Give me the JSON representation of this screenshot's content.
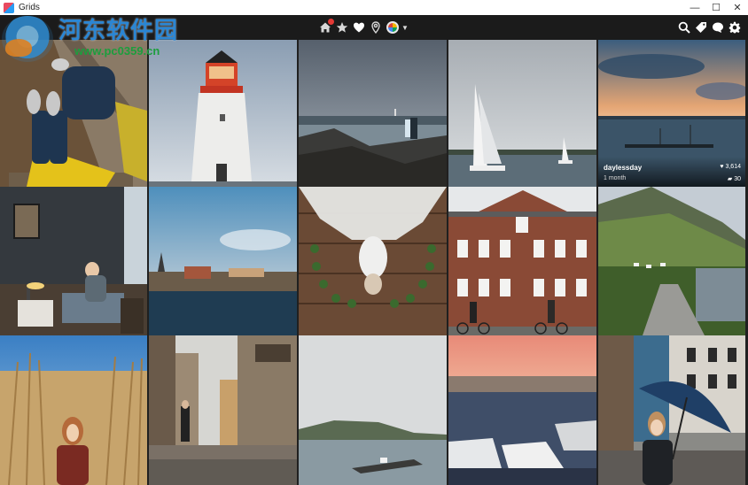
{
  "window": {
    "title": "Grids"
  },
  "watermark": {
    "text": "河东软件园",
    "url": "www.pc0359.cn"
  },
  "toolbar": {
    "center_icons": [
      "home-icon",
      "star-icon",
      "heart-icon",
      "location-pin-icon",
      "profile-avatar",
      "dropdown-caret-icon"
    ],
    "right_icons": [
      "search-icon",
      "tag-icon",
      "chat-icon",
      "gear-icon"
    ],
    "notification": true
  },
  "photo_overlay": {
    "username": "daylessday",
    "age": "1 month",
    "likes": "3,614",
    "comments": "30"
  },
  "colors": {
    "titlebar_bg": "#ffffff",
    "toolbar_bg": "#1b1b1b",
    "grid_bg": "#202020",
    "badge": "#e53935"
  }
}
